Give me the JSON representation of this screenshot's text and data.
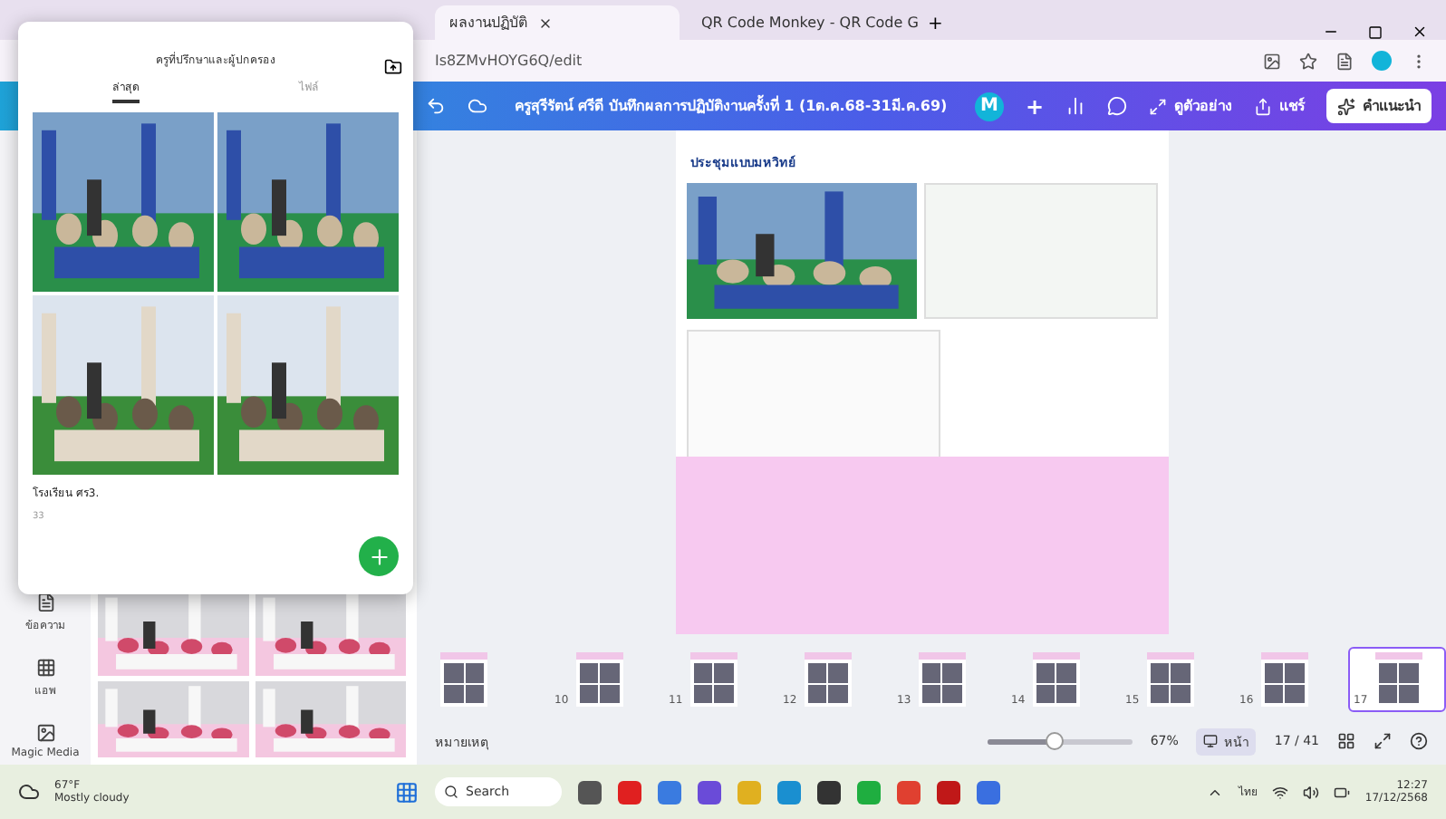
{
  "browser": {
    "tabs": [
      {
        "title": "ผลงานปฏิบัติ",
        "selected": true
      },
      {
        "title": "QR Code Monkey - QR Code G",
        "selected": false
      }
    ],
    "new_tab": "+",
    "url": "Is8ZMvHOYG6Q/edit"
  },
  "editor": {
    "title": "ครูสุรีรัตน์ ศรีดี บันทึกผลการปฏิบัติงานครั้งที่ 1 (1ต.ค.68-31มี.ค.69)",
    "avatar": "M",
    "add": "+",
    "preview": "ดูตัวอย่าง",
    "share": "แชร์",
    "present": "คำแนะนำ"
  },
  "side_tools": [
    {
      "label": "ข้อความ"
    },
    {
      "label": "แอพ"
    },
    {
      "label": "Magic Media"
    }
  ],
  "photo_panel": {
    "title": "ครูที่ปรึกษาและผู้ปกครอง",
    "tabs": [
      {
        "label": "ล่าสุด",
        "selected": true
      },
      {
        "label": "ไฟล์",
        "selected": false
      }
    ],
    "album": {
      "name": "โรงเรียน ศร3.",
      "count": "33"
    }
  },
  "slide": {
    "caption": "ประชุมแบบมหวิทย์"
  },
  "thumbnails": [
    {
      "selected": false
    },
    {
      "number": "10",
      "selected": false
    },
    {
      "number": "11",
      "selected": false
    },
    {
      "number": "12",
      "selected": false
    },
    {
      "number": "13",
      "selected": false
    },
    {
      "number": "14",
      "selected": false
    },
    {
      "number": "15",
      "selected": false
    },
    {
      "number": "16",
      "selected": false
    },
    {
      "number": "17",
      "selected": true
    }
  ],
  "footer": {
    "notes": "หมายเหตุ",
    "zoom_slider": {
      "level": 0.47
    },
    "zoom": "67%",
    "pages_label": "หน้า",
    "page": "17 / 41"
  },
  "taskbar": {
    "temperature": "67°F",
    "weather": "Mostly cloudy",
    "search": "Search",
    "language": "ไทย",
    "time": "12:27",
    "date": "17/12/2568"
  }
}
